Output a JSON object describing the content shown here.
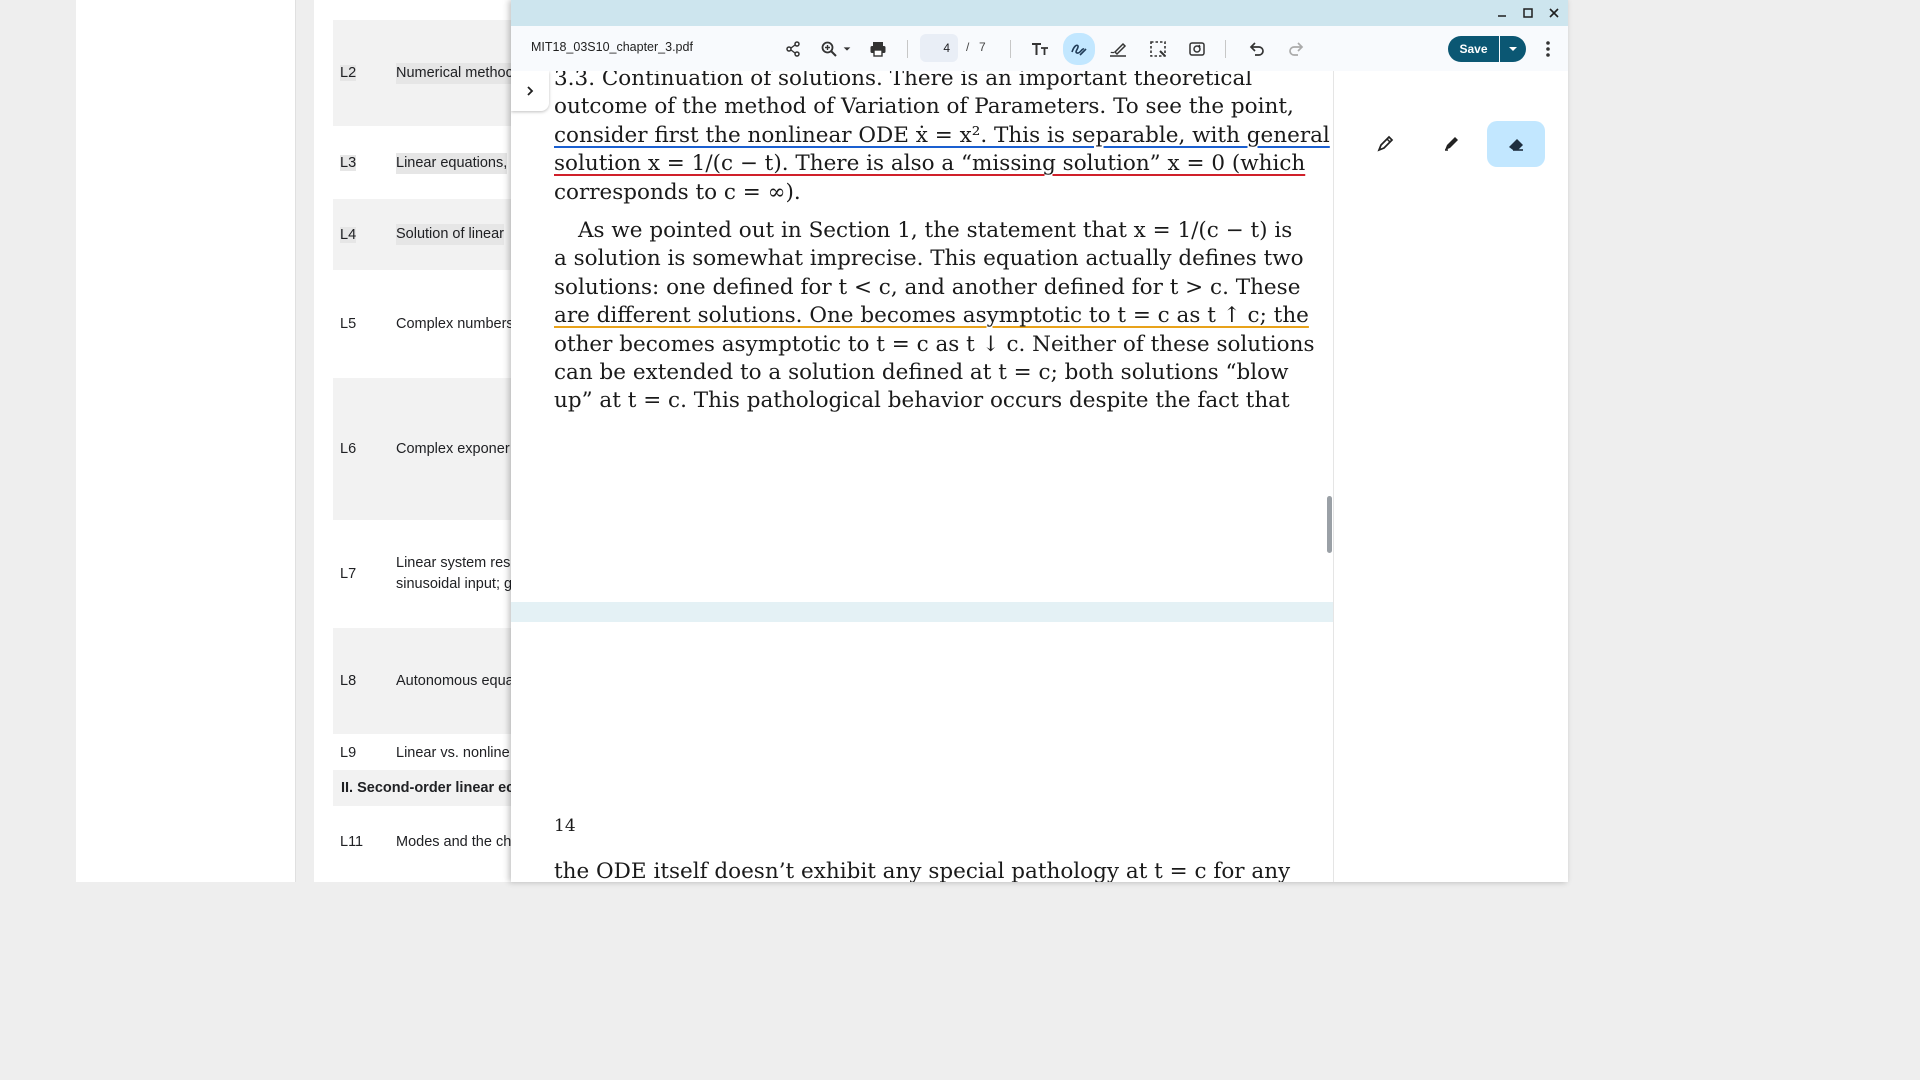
{
  "background_page": {
    "rows": [
      {
        "num": "L2",
        "title": "Numerical methoc",
        "shaded": true,
        "highlight": true
      },
      {
        "num": "L3",
        "title": "Linear equations,",
        "shaded": false,
        "highlight": true
      },
      {
        "num": "L4",
        "title": "Solution of linear",
        "shaded": true,
        "highlight": true
      },
      {
        "num": "L5",
        "title": "Complex numbers",
        "shaded": false,
        "highlight": false
      },
      {
        "num": "L6",
        "title": "Complex exponer",
        "shaded": true,
        "highlight": false
      },
      {
        "num": "L7",
        "title": "Linear system res",
        "title2": "sinusoidal input; g",
        "shaded": false,
        "highlight": false
      },
      {
        "num": "L8",
        "title": "Autonomous equa",
        "shaded": true,
        "highlight": false
      },
      {
        "num": "L9",
        "title": "Linear vs. nonline",
        "shaded": false,
        "highlight": false
      },
      {
        "num": "L11",
        "title": "Modes and the ch",
        "shaded": false,
        "highlight": false
      }
    ],
    "section_header": "II. Second-order linear ec"
  },
  "viewer": {
    "filename": "MIT18_03S10_chapter_3.pdf",
    "page_current": "4",
    "page_separator": "/",
    "page_total": "7",
    "save_label": "Save",
    "window_controls": [
      "minimize-icon",
      "maximize-icon",
      "close-icon"
    ],
    "toolbar_icons": [
      "share-icon",
      "zoom-icon",
      "print-icon",
      "text-icon",
      "draw-icon",
      "highlight-icon",
      "select-area-icon",
      "rotate-icon",
      "undo-icon",
      "redo-icon"
    ],
    "accent_color": "#0b5773",
    "active_tool_color": "#c2e7ff"
  },
  "pdf": {
    "lines": [
      "3.3. Continuation of solutions. There is an important theoretical",
      "outcome of the method of Variation of Parameters. To see the point,",
      "consider first the nonlinear ODE ẋ = x². This is separable, with general",
      "solution x = 1/(c − t). There is also a “missing solution” x = 0 (which",
      "corresponds to c = ∞).",
      "As we pointed out in Section 1, the statement that x = 1/(c − t) is",
      "a solution is somewhat imprecise. This equation actually defines two",
      "solutions: one defined for t < c, and another defined for t > c. These",
      "are different solutions. One becomes asymptotic to t = c as t ↑ c; the",
      "other becomes asymptotic to t = c as t ↓ c. Neither of these solutions",
      "can be extended to a solution defined at t = c; both solutions “blow",
      "up” at t = c. This pathological behavior occurs despite the fact that"
    ],
    "page_number": "14",
    "next_page_line": "the ODE itself doesn’t exhibit any special pathology at t = c for any"
  },
  "annotation_panel": {
    "tools": [
      "pen-icon",
      "highlighter-icon",
      "eraser-icon"
    ],
    "active_tool": "eraser-icon"
  }
}
